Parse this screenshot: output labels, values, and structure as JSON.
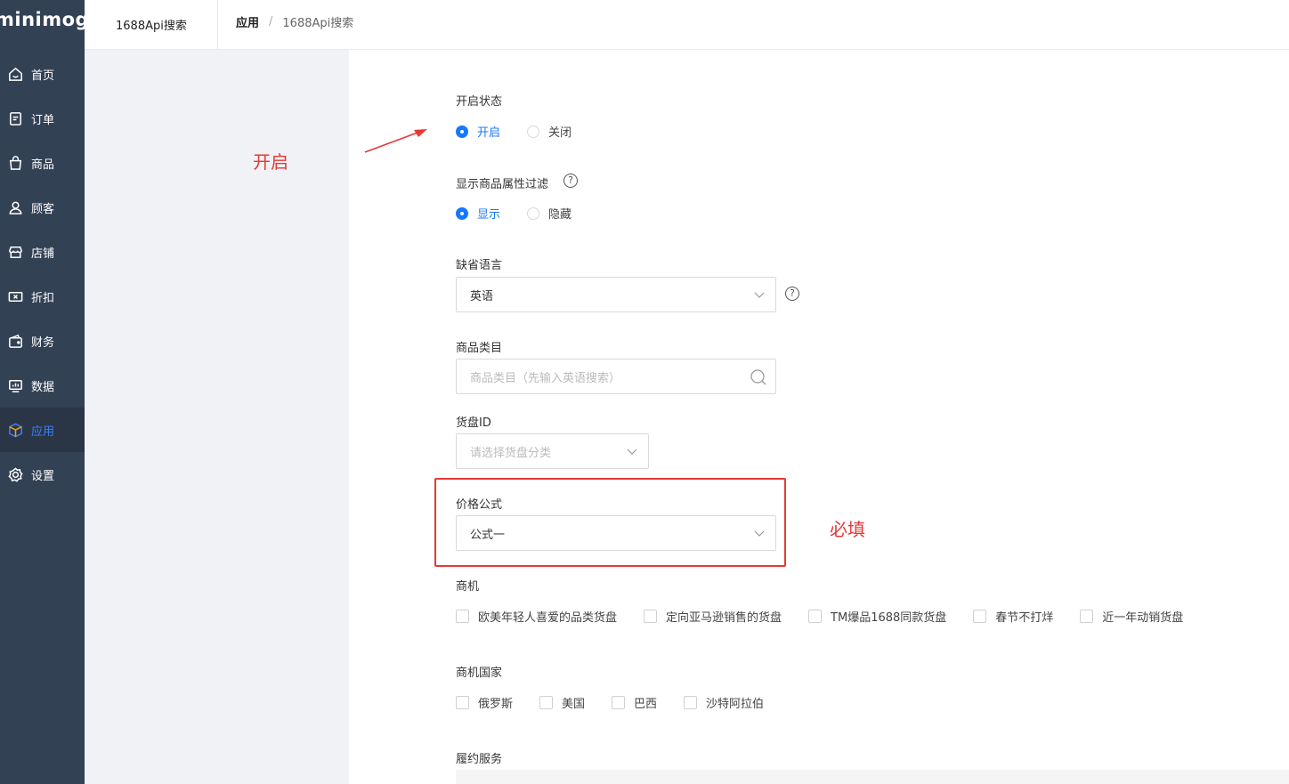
{
  "sidebar": {
    "logo": "minimog",
    "items": [
      {
        "label": "首页",
        "icon": "home-icon"
      },
      {
        "label": "订单",
        "icon": "order-icon"
      },
      {
        "label": "商品",
        "icon": "bag-icon"
      },
      {
        "label": "顾客",
        "icon": "user-icon"
      },
      {
        "label": "店铺",
        "icon": "store-icon"
      },
      {
        "label": "折扣",
        "icon": "discount-icon"
      },
      {
        "label": "财务",
        "icon": "wallet-icon"
      },
      {
        "label": "数据",
        "icon": "chart-icon"
      },
      {
        "label": "应用",
        "icon": "cube-icon",
        "active": true
      },
      {
        "label": "设置",
        "icon": "gear-icon"
      }
    ],
    "active_color": "#3b82f6"
  },
  "topbar": {
    "tab": "1688Api搜索",
    "breadcrumb_root": "应用",
    "breadcrumb_sep": "/",
    "breadcrumb_current": "1688Api搜索"
  },
  "annotations": {
    "open": "开启",
    "required": "必填",
    "color": "#e53935"
  },
  "form": {
    "status": {
      "label": "开启状态",
      "options": [
        "开启",
        "关闭"
      ],
      "selected": "开启"
    },
    "attr_filter": {
      "label": "显示商品属性过滤",
      "options": [
        "显示",
        "隐藏"
      ],
      "selected": "显示"
    },
    "language": {
      "label": "缺省语言",
      "value": "英语"
    },
    "category": {
      "label": "商品类目",
      "placeholder": "商品类目（先输入英语搜索）"
    },
    "supply_id": {
      "label": "货盘ID",
      "placeholder": "请选择货盘分类"
    },
    "price_formula": {
      "label": "价格公式",
      "value": "公式一"
    },
    "opportunity": {
      "label": "商机",
      "options": [
        "欧美年轻人喜爱的品类货盘",
        "定向亚马逊销售的货盘",
        "TM爆品1688同款货盘",
        "春节不打烊",
        "近一年动销货盘"
      ]
    },
    "opportunity_country": {
      "label": "商机国家",
      "options": [
        "俄罗斯",
        "美国",
        "巴西",
        "沙特阿拉伯"
      ]
    },
    "fulfillment": {
      "label": "履约服务"
    }
  }
}
